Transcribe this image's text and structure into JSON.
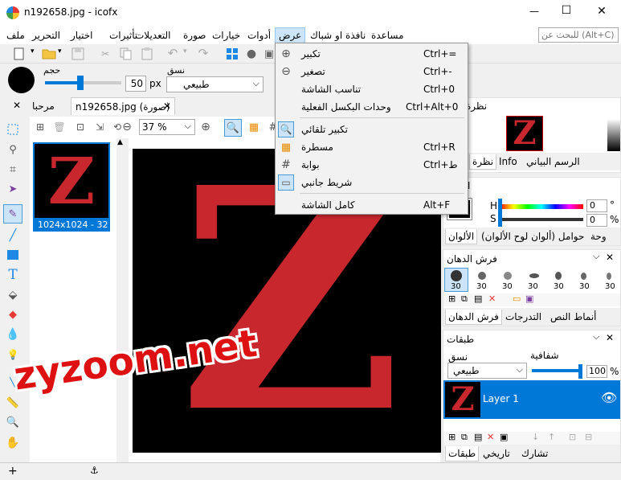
{
  "window": {
    "title": "n192658.jpg - icofx",
    "minimize": "—",
    "maximize": "☐",
    "close": "✕"
  },
  "menu": {
    "items": [
      "ملف",
      "التحرير",
      "اختيار",
      "تأثيرات",
      "التعديلات",
      "صورة",
      "خيارات",
      "أدوات",
      "عرض",
      "نافذة او شباك",
      "مساعدة"
    ],
    "search_placeholder": "للبحث عن (Alt+C)..."
  },
  "toolbar2": {
    "size_label": "حجم",
    "size_value": "50",
    "size_unit": "px",
    "blend_label": "نسق",
    "blend_value": "طبيعي"
  },
  "tabs": {
    "welcome": "مرحبا",
    "doc": "n192658.jpg (صورة)",
    "doc_close": "✕",
    "close_all": "✕"
  },
  "doc_toolbar": {
    "zoom_value": "37 %"
  },
  "thumbnail": {
    "caption": "1024x1024 - 32"
  },
  "watermark": "zyzoom.net",
  "view_menu": {
    "items": [
      {
        "label": "تكبير",
        "shortcut": "Ctrl+="
      },
      {
        "label": "تصغير",
        "shortcut": "Ctrl+-"
      },
      {
        "label": "تناسب الشاشة",
        "shortcut": "Ctrl+0"
      },
      {
        "label": "وحدات البكسل الفعلية",
        "shortcut": "Ctrl+Alt+0"
      },
      {
        "label": "تكبير تلقائي",
        "shortcut": ""
      },
      {
        "label": "مسطرة",
        "shortcut": "Ctrl+R"
      },
      {
        "label": "بوابة",
        "shortcut": "Ctrl+ط"
      },
      {
        "label": "شريط جانبي",
        "shortcut": ""
      },
      {
        "label": "كامل الشاشة",
        "shortcut": "Alt+F"
      }
    ]
  },
  "nav_panel": {
    "title": "نظرة",
    "tabs": [
      "الرسم البياني",
      "Info",
      "نظرة"
    ]
  },
  "color_panel": {
    "title": "ا",
    "h_label": "H",
    "h_value": "0",
    "h_unit": "°",
    "s_label": "S",
    "s_value": "0",
    "s_unit": "%",
    "tabs": [
      "وحة",
      "حوامل (ألوان لوح الألوان)",
      "الألوان"
    ]
  },
  "brush_panel": {
    "title": "فرش الدهان",
    "sizes": [
      "30",
      "30",
      "30",
      "30",
      "30",
      "30",
      "30"
    ],
    "tabs": [
      "أنماط النص",
      "التدرجات",
      "فرش الدهان"
    ]
  },
  "layers_panel": {
    "title": "طبقات",
    "opacity_label": "شفافية",
    "opacity_value": "100",
    "opacity_unit": "%",
    "blend_label": "نسق",
    "blend_value": "طبيعي",
    "layer_name": "Layer 1",
    "tabs": [
      "تشارك",
      "تاريخي",
      "طبقات"
    ]
  },
  "colors": {
    "accent": "#0078d7",
    "z_red": "#c8282d"
  }
}
